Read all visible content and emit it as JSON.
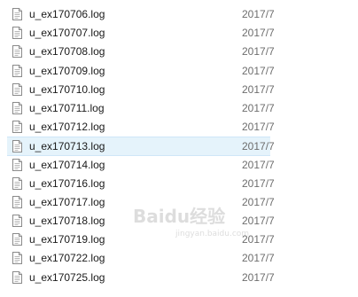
{
  "files": [
    {
      "name": "u_ex170706.log",
      "date": "2017/7"
    },
    {
      "name": "u_ex170707.log",
      "date": "2017/7"
    },
    {
      "name": "u_ex170708.log",
      "date": "2017/7"
    },
    {
      "name": "u_ex170709.log",
      "date": "2017/7"
    },
    {
      "name": "u_ex170710.log",
      "date": "2017/7"
    },
    {
      "name": "u_ex170711.log",
      "date": "2017/7"
    },
    {
      "name": "u_ex170712.log",
      "date": "2017/7"
    },
    {
      "name": "u_ex170713.log",
      "date": "2017/7",
      "hovered": true
    },
    {
      "name": "u_ex170714.log",
      "date": "2017/7"
    },
    {
      "name": "u_ex170716.log",
      "date": "2017/7"
    },
    {
      "name": "u_ex170717.log",
      "date": "2017/7"
    },
    {
      "name": "u_ex170718.log",
      "date": "2017/7"
    },
    {
      "name": "u_ex170719.log",
      "date": "2017/7"
    },
    {
      "name": "u_ex170722.log",
      "date": "2017/7"
    },
    {
      "name": "u_ex170725.log",
      "date": "2017/7"
    }
  ],
  "icons": {
    "file": "text-file-icon"
  },
  "colors": {
    "hover_background": "#e5f3fb",
    "hover_border": "#cfe6f8",
    "date_text": "#6d6d6d"
  },
  "watermark": {
    "text": "Baidu经验",
    "subtext": "jingyan.baidu.com"
  }
}
